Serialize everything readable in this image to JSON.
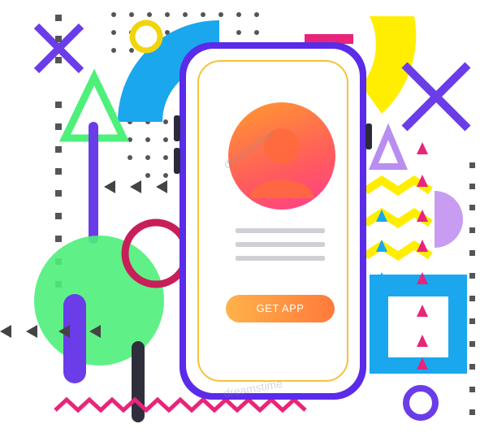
{
  "app_card": {
    "get_app_label": "GET APP"
  },
  "watermark": {
    "text": "dreamstime"
  },
  "colors": {
    "phone_frame": "#5a2be8",
    "screen_border": "#f5c23a",
    "button_start": "#ffb24a",
    "button_end": "#ff7a3a",
    "accent_purple": "#6a3de8",
    "accent_green": "#4ef07a",
    "accent_blue": "#1aa7ee",
    "accent_pink": "#e8257a",
    "accent_yellow": "#ffee00"
  },
  "icons": [
    "user-avatar-icon",
    "triangle-icon",
    "cross-icon",
    "circle-icon",
    "zigzag-icon"
  ]
}
